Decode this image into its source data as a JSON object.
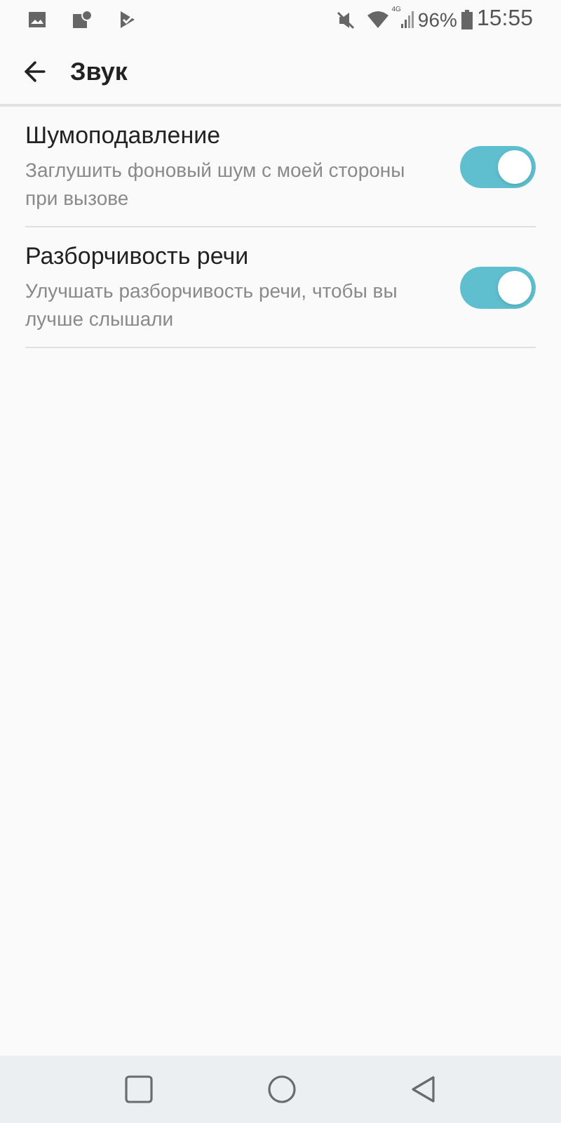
{
  "status_bar": {
    "network": "4G",
    "battery": "96%",
    "time": "15:55"
  },
  "header": {
    "title": "Звук"
  },
  "settings": [
    {
      "title": "Шумоподавление",
      "summary": "Заглушить фоновый шум с моей стороны при вызове",
      "on": true
    },
    {
      "title": "Разборчивость речи",
      "summary": "Улучшать разборчивость речи, чтобы вы лучше слышали",
      "on": true
    }
  ]
}
